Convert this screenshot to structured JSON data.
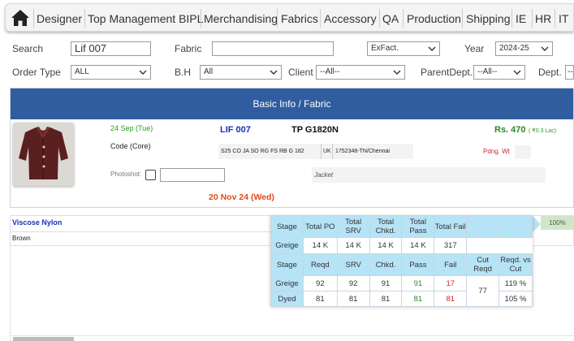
{
  "nav": {
    "items": [
      "Designer",
      "Top Management BIPL",
      "Merchandising",
      "Fabrics",
      "Accessory",
      "QA",
      "Production",
      "Shipping",
      "IE",
      "HR",
      "IT"
    ]
  },
  "filters": {
    "search_label": "Search",
    "search_value": "Lif 007",
    "fabric_label": "Fabric",
    "fabric_value": "",
    "date_type": "ExFact.",
    "year_label": "Year",
    "year_value": "2024-25",
    "order_type_label": "Order Type",
    "order_type_value": "ALL",
    "bh_label": "B.H",
    "bh_value": "All",
    "client_label": "Client",
    "client_value": "--All--",
    "parent_dept_label": "ParentDept.",
    "parent_dept_value": "--All--",
    "dept_label": "Dept.",
    "dept_value": "--"
  },
  "card": {
    "header": "Basic Info / Fabric",
    "date": "24 Sep (Tue)",
    "code": "Code (Core)",
    "style_no": "LIF 007",
    "style_ref": "TP G1820N",
    "description": "S25 CO JA SO RG FS RB G 182",
    "country": "UK",
    "po_ref": "1752348-TN/Chennai",
    "price": "Rs. 470",
    "price_lac": "( ₹0.3 Lac)",
    "pending": "Pdng. Wt",
    "photoshot_label": "Photoshot:",
    "photoshot_value": "",
    "category": "Jacket",
    "ex_factory": "20 Nov 24 (Wed)"
  },
  "fabric_row": {
    "fabric": "Viscose Nylon",
    "color": "Brown",
    "percent": "100%"
  },
  "stage_table": {
    "header1": [
      "Stage",
      "Total PO",
      "Total SRV",
      "Total Chkd.",
      "Total Pass",
      "Total Fail",
      "",
      ""
    ],
    "row1": [
      "Greige",
      "14 K",
      "14 K",
      "14 K",
      "14 K",
      "317"
    ],
    "header2": [
      "Stage",
      "Reqd",
      "SRV",
      "Chkd.",
      "Pass",
      "Fail",
      "Cut Reqd",
      "Reqd. vs Cut"
    ],
    "rows": [
      {
        "stage": "Greige",
        "reqd": "92",
        "srv": "92",
        "chkd": "91",
        "pass": "91",
        "fail": "17",
        "pct": "119 %"
      },
      {
        "stage": "Dyed",
        "reqd": "81",
        "srv": "81",
        "chkd": "81",
        "pass": "81",
        "fail": "81",
        "pct": "105 %"
      }
    ],
    "cut_reqd": "77"
  },
  "colors": {
    "header_blue": "#2f5d9f",
    "table_header": "#b7e3f6",
    "price_green": "#2a8a2a",
    "alert_red": "#d62828",
    "date_orange": "#e04a1b"
  }
}
